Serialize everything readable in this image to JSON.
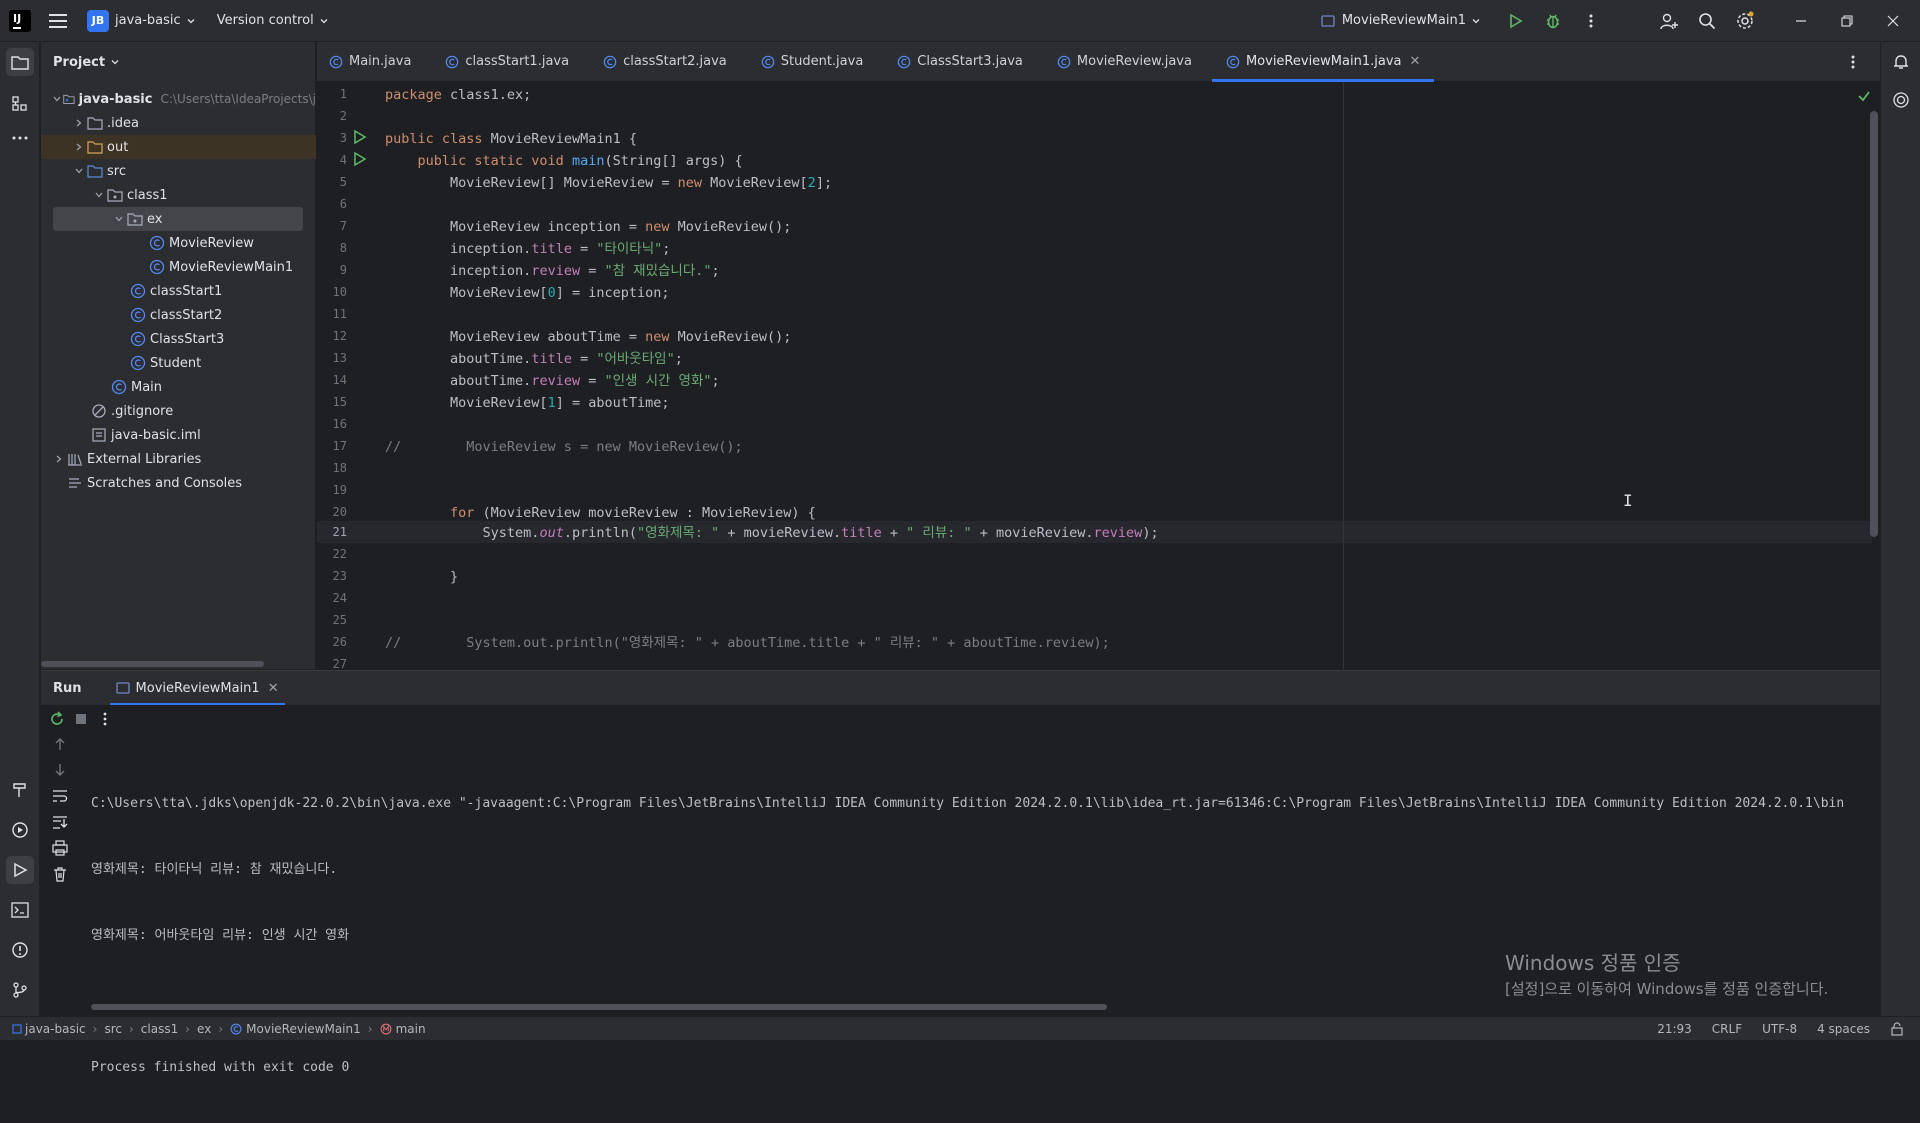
{
  "titlebar": {
    "project_badge": "JB",
    "project_name": "java-basic",
    "vcs_label": "Version control",
    "run_config": "MovieReviewMain1"
  },
  "project_panel": {
    "header": "Project",
    "tree": [
      {
        "label": "java-basic",
        "path": "C:\\Users\\tta\\IdeaProjects\\j",
        "icon": "module-folder-icon",
        "expanded": true
      },
      {
        "label": ".idea",
        "icon": "folder-icon",
        "expanded": false
      },
      {
        "label": "out",
        "icon": "folder-icon",
        "expanded": false
      },
      {
        "label": "src",
        "icon": "source-folder-icon",
        "expanded": true
      },
      {
        "label": "class1",
        "icon": "package-icon",
        "expanded": true
      },
      {
        "label": "ex",
        "icon": "package-icon",
        "expanded": true
      },
      {
        "label": "MovieReview",
        "icon": "class-icon"
      },
      {
        "label": "MovieReviewMain1",
        "icon": "class-icon"
      },
      {
        "label": "classStart1",
        "icon": "class-icon"
      },
      {
        "label": "classStart2",
        "icon": "class-icon"
      },
      {
        "label": "ClassStart3",
        "icon": "class-icon"
      },
      {
        "label": "Student",
        "icon": "class-icon"
      },
      {
        "label": "Main",
        "icon": "class-icon"
      },
      {
        "label": ".gitignore",
        "icon": "ignore-file-icon"
      },
      {
        "label": "java-basic.iml",
        "icon": "iml-file-icon"
      },
      {
        "label": "External Libraries",
        "icon": "library-icon",
        "expanded": false
      },
      {
        "label": "Scratches and Consoles",
        "icon": "scratches-icon"
      }
    ]
  },
  "tabs": [
    {
      "label": "Main.java"
    },
    {
      "label": "classStart1.java"
    },
    {
      "label": "classStart2.java"
    },
    {
      "label": "Student.java"
    },
    {
      "label": "ClassStart3.java"
    },
    {
      "label": "MovieReview.java"
    },
    {
      "label": "MovieReviewMain1.java",
      "active": true
    }
  ],
  "editor": {
    "line_numbers": [
      "1",
      "2",
      "3",
      "4",
      "5",
      "6",
      "7",
      "8",
      "9",
      "10",
      "11",
      "12",
      "13",
      "14",
      "15",
      "16",
      "17",
      "18",
      "19",
      "20",
      "21",
      "22",
      "23",
      "24",
      "25",
      "26",
      "27"
    ],
    "current_line": "21"
  },
  "run_panel": {
    "title": "Run",
    "tab_label": "MovieReviewMain1",
    "console": [
      "C:\\Users\\tta\\.jdks\\openjdk-22.0.2\\bin\\java.exe \"-javaagent:C:\\Program Files\\JetBrains\\IntelliJ IDEA Community Edition 2024.2.0.1\\lib\\idea_rt.jar=61346:C:\\Program Files\\JetBrains\\IntelliJ IDEA Community Edition 2024.2.0.1\\bin",
      "영화제목: 타이타닉 리뷰: 참 재밌습니다.",
      "영화제목: 어바웃타임 리뷰: 인생 시간 영화",
      "",
      "Process finished with exit code 0"
    ],
    "watermark_title": "Windows 정품 인증",
    "watermark_sub": "[설정]으로 이동하여 Windows를 정품 인증합니다."
  },
  "statusbar": {
    "breadcrumbs": [
      "java-basic",
      "src",
      "class1",
      "ex",
      "MovieReviewMain1",
      "main"
    ],
    "position": "21:93",
    "line_sep": "CRLF",
    "encoding": "UTF-8",
    "indent": "4 spaces"
  },
  "colors": {
    "accent": "#3574f0",
    "keyword": "#cf8e6d",
    "string": "#6aab73",
    "function": "#56a8f5",
    "field": "#c77dbb",
    "number": "#2aacb8",
    "run_green": "#5fb865"
  }
}
